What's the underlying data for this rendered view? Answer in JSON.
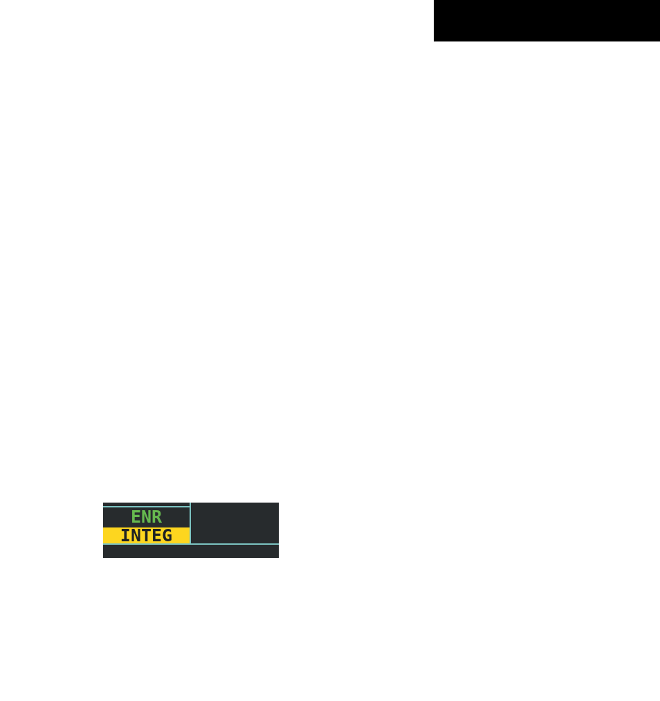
{
  "display": {
    "annunciators": [
      {
        "kind": "mode",
        "text": "ENR"
      },
      {
        "kind": "alert",
        "text": "INTEG"
      }
    ]
  }
}
